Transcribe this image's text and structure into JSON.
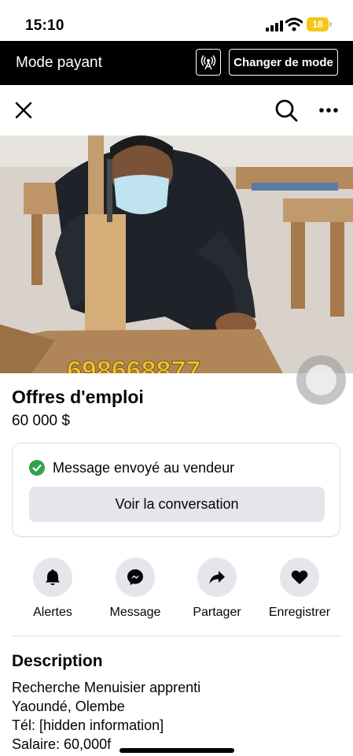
{
  "status_bar": {
    "time": "15:10",
    "battery_level": "18",
    "battery_color": "#f5c518"
  },
  "mode_bar": {
    "title": "Mode payant",
    "broadcast_icon": "broadcast-icon",
    "switch_label": "Changer de mode"
  },
  "nav": {
    "close_icon": "close-icon",
    "search_icon": "search-icon",
    "more_icon": "more-icon"
  },
  "listing": {
    "image_alt": "photo",
    "watermark_phone": "698668877",
    "title": "Offres d'emploi",
    "price": "60 000 $"
  },
  "message": {
    "sent_text": "Message envoyé au vendeur",
    "view_button": "Voir la conversation",
    "check_color": "#31a24c"
  },
  "actions": [
    {
      "label": "Alertes",
      "icon": "bell-icon"
    },
    {
      "label": "Message",
      "icon": "messenger-icon"
    },
    {
      "label": "Partager",
      "icon": "share-icon"
    },
    {
      "label": "Enregistrer",
      "icon": "heart-icon"
    }
  ],
  "description": {
    "heading": "Description",
    "lines": [
      "Recherche Menuisier apprenti",
      "Yaoundé, Olembe",
      "Tél: [hidden information]",
      "Salaire: 60,000f"
    ]
  }
}
